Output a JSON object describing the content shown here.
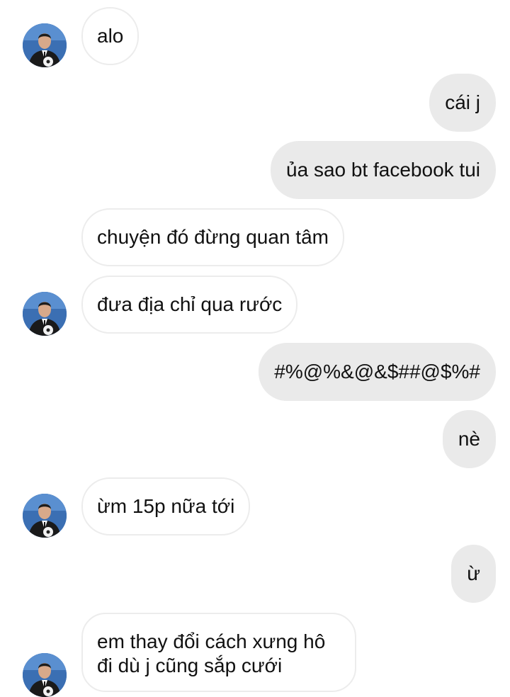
{
  "chat": {
    "messages": [
      {
        "side": "received",
        "text": "alo"
      },
      {
        "side": "sent",
        "text": "cái j"
      },
      {
        "side": "sent",
        "text": "ủa sao bt facebook tui"
      },
      {
        "side": "received",
        "text": "chuyện đó đừng quan tâm"
      },
      {
        "side": "received",
        "text": " đưa địa chỉ qua rước"
      },
      {
        "side": "sent",
        "text": "#%@%&@&$##@$%#"
      },
      {
        "side": "sent",
        "text": "nè"
      },
      {
        "side": "received",
        "text": "ừm 15p nữa tới"
      },
      {
        "side": "sent",
        "text": "ừ"
      },
      {
        "side": "received",
        "lines": [
          "em thay đổi cách xưng hô",
          "đi dù j cũng sắp cưới"
        ]
      }
    ]
  },
  "colors": {
    "sent_bubble": "#eaeaea",
    "received_border": "#ececec",
    "avatar_bg": "#3b6fb3"
  },
  "icons": {
    "avatar": "contact-avatar-photo"
  }
}
